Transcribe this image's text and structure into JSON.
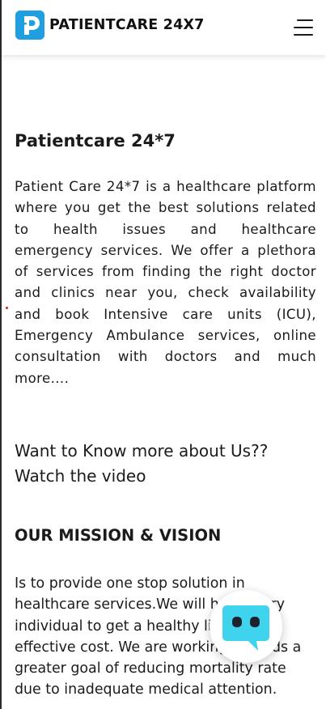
{
  "header": {
    "brand": "PATIENTCARE 24X7",
    "logo_icon": "patientcare-logo-icon",
    "menu_icon": "hamburger-menu-icon",
    "brand_color": "#1f9ee0"
  },
  "about": {
    "title": "Patientcare 24*7",
    "text": "Patient Care 24*7 is a healthcare platform where you get the best solutions related to health issues and healthcare emergency services. We offer a plethora of services from finding the right doctor and clinics near you, check availability and book Intensive care units (ICU), Emergency Ambulance services, online consultation with doctors and much more...."
  },
  "video": {
    "prompt_line1": "Want to Know more about Us??",
    "prompt_line2": "Watch the video"
  },
  "mission": {
    "title": "OUR MISSION & VISION",
    "text": "Is to provide one stop solution in healthcare services.We will help every individual to get a healthy life at an effective cost. We are working towards a greater goal of reducing mortality rate due to inadequate medical attention."
  },
  "chat": {
    "icon": "chatbot-icon",
    "color": "#3fd3ee"
  }
}
